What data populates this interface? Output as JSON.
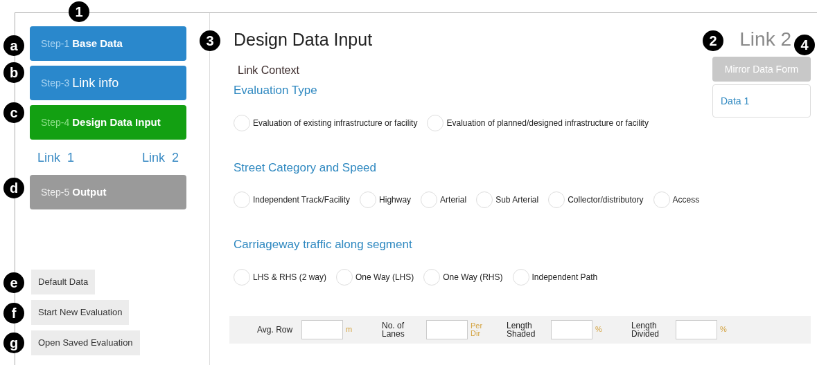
{
  "sidebar": {
    "steps": [
      {
        "step": "Step-1",
        "label": "Base Data",
        "selected": false,
        "bold": true
      },
      {
        "step": "Step-3",
        "label": "Link info",
        "selected": false,
        "bold": false
      },
      {
        "step": "Step-4",
        "label": "Design Data Input",
        "selected": true,
        "bold": true
      }
    ],
    "links": [
      {
        "label": "Link  1"
      },
      {
        "label": "Link  2"
      }
    ],
    "final_step": {
      "step": "Step-5",
      "label": "Output",
      "disabled": true,
      "bold": true
    },
    "actions": [
      "Default Data",
      "Start New Evaluation",
      "Open Saved Evaluation"
    ]
  },
  "main": {
    "title": "Design Data Input",
    "link_name": "Link 2",
    "subtitle": "Link Context",
    "mirror_button": "Mirror Data Form",
    "data_item": "Data 1",
    "groups": [
      {
        "heading": "Evaluation Type",
        "options": [
          {
            "label": "Evaluation of existing infrastructure or facility",
            "selected": false
          },
          {
            "label": "Evaluation of planned/designed infrastructure or facility",
            "selected": false
          }
        ]
      },
      {
        "heading": "Street Category and Speed",
        "options": [
          {
            "label": "Independent Track/Facility",
            "selected": false
          },
          {
            "label": "Highway",
            "selected": false
          },
          {
            "label": "Arterial",
            "selected": false
          },
          {
            "label": "Sub Arterial",
            "selected": false
          },
          {
            "label": "Collector/distributory",
            "selected": false
          },
          {
            "label": "Access",
            "selected": false
          }
        ]
      },
      {
        "heading": "Carriageway traffic along segment",
        "options": [
          {
            "label": "LHS & RHS (2 way)",
            "selected": false
          },
          {
            "label": "One Way (LHS)",
            "selected": false
          },
          {
            "label": "One Way (RHS)",
            "selected": false
          },
          {
            "label": "Independent Path",
            "selected": false
          }
        ]
      }
    ],
    "fields": [
      {
        "label": "Avg. Row",
        "unit": "m"
      },
      {
        "label": "No. of Lanes",
        "unit": "Per Dir"
      },
      {
        "label": "Length Shaded",
        "unit": "%"
      },
      {
        "label": "Length Divided",
        "unit": "%"
      }
    ]
  },
  "callouts": [
    {
      "mark": "1"
    },
    {
      "mark": "3"
    },
    {
      "mark": "2"
    },
    {
      "mark": "a"
    },
    {
      "mark": "4"
    },
    {
      "mark": "b"
    },
    {
      "mark": "c"
    },
    {
      "mark": "d"
    },
    {
      "mark": "e"
    },
    {
      "mark": "f"
    },
    {
      "mark": "g"
    }
  ]
}
